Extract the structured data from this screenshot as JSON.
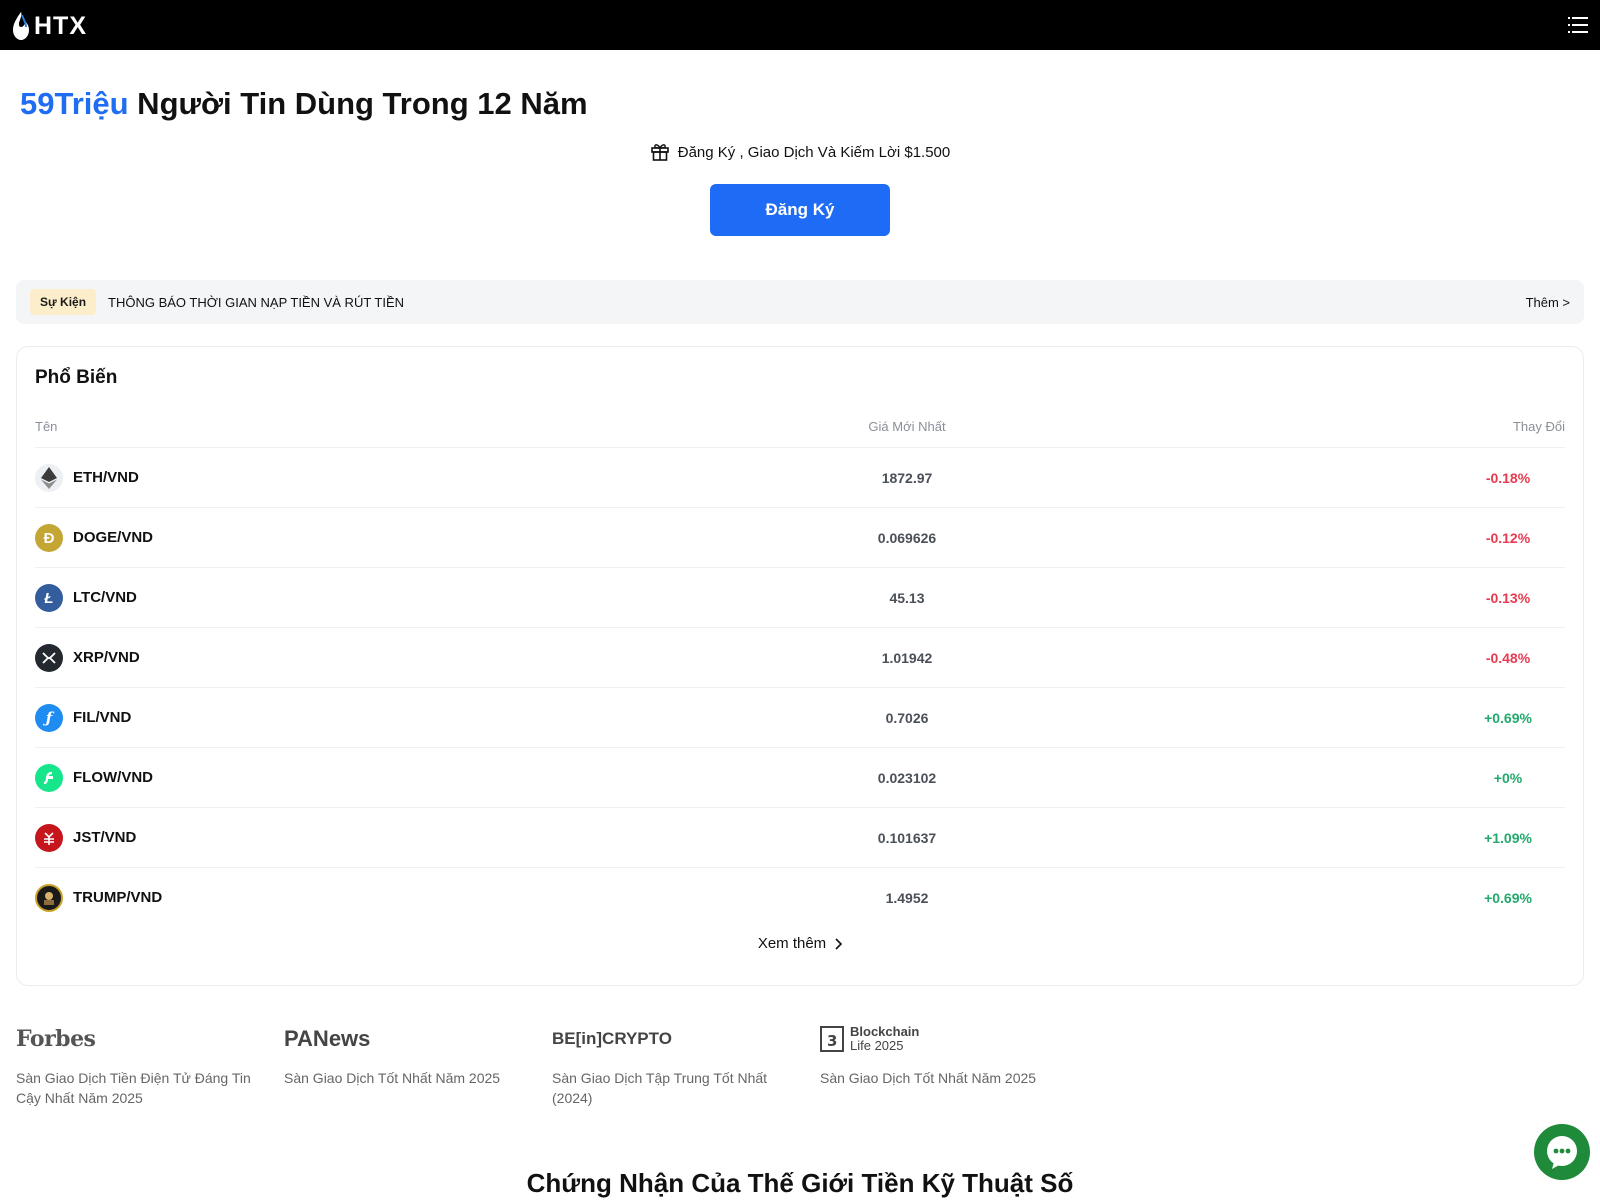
{
  "header": {
    "logo_text": "HTX",
    "menu_icon": "menu-icon"
  },
  "hero": {
    "title_accent": "59Triệu",
    "title_rest": " Người Tin Dùng Trong 12 Năm",
    "promo_icon": "gift-icon",
    "promo_text": "Đăng Ký , Giao Dịch Và Kiếm Lời $1.500",
    "signup_label": "Đăng Ký",
    "accent_color": "#1f6df2"
  },
  "event": {
    "badge": "Sự Kiện",
    "text": "THÔNG BÁO THỜI GIAN NẠP TIỀN VÀ RÚT TIỀN",
    "more": "Thêm >"
  },
  "popular": {
    "title": "Phổ Biến",
    "columns": {
      "name": "Tên",
      "price": "Giá Mới Nhất",
      "change": "Thay Đổi"
    },
    "rows": [
      {
        "icon": "ethereum-icon",
        "pair": "ETH/VND",
        "price": "1872.97",
        "change": "-0.18%",
        "direction": "down"
      },
      {
        "icon": "dogecoin-icon",
        "pair": "DOGE/VND",
        "price": "0.069626",
        "change": "-0.12%",
        "direction": "down"
      },
      {
        "icon": "litecoin-icon",
        "pair": "LTC/VND",
        "price": "45.13",
        "change": "-0.13%",
        "direction": "down"
      },
      {
        "icon": "xrp-icon",
        "pair": "XRP/VND",
        "price": "1.01942",
        "change": "-0.48%",
        "direction": "down"
      },
      {
        "icon": "filecoin-icon",
        "pair": "FIL/VND",
        "price": "0.7026",
        "change": "+0.69%",
        "direction": "up"
      },
      {
        "icon": "flow-icon",
        "pair": "FLOW/VND",
        "price": "0.023102",
        "change": "+0%",
        "direction": "up"
      },
      {
        "icon": "just-icon",
        "pair": "JST/VND",
        "price": "0.101637",
        "change": "+1.09%",
        "direction": "up"
      },
      {
        "icon": "trump-icon",
        "pair": "TRUMP/VND",
        "price": "1.4952",
        "change": "+0.69%",
        "direction": "up"
      }
    ],
    "see_more": "Xem thêm",
    "negative_color": "#e83a4f",
    "positive_color": "#22a96b"
  },
  "awards": [
    {
      "logo": "Forbes",
      "text": "Sàn Giao Dịch Tiền Điện Tử Đáng Tin Cậy Nhất Năm 2025"
    },
    {
      "logo": "PANews",
      "text": "Sàn Giao Dịch Tốt Nhất Năm 2025"
    },
    {
      "logo": "BE[in]CRYPTO",
      "text": "Sàn Giao Dịch Tập Trung Tốt Nhất (2024)"
    },
    {
      "logo_line1": "Blockchain",
      "logo_line2": "Life 2025",
      "text": "Sàn Giao Dịch Tốt Nhất Năm 2025"
    }
  ],
  "bottom_heading": "Chứng Nhận Của Thế Giới Tiền Kỹ Thuật Số",
  "chat_icon": "chat-bubble-icon"
}
